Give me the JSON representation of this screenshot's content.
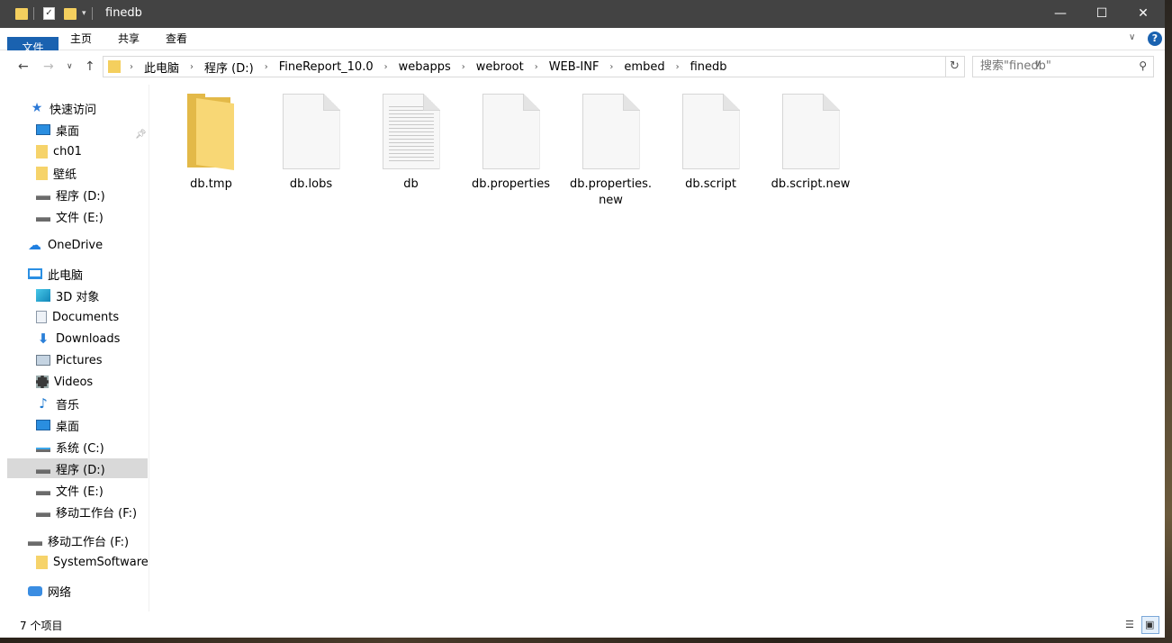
{
  "window": {
    "title": "finedb",
    "controls": [
      "minimize-icon",
      "maximize-icon",
      "close-icon"
    ]
  },
  "ribbon": {
    "tabs": [
      "文件",
      "主页",
      "共享",
      "查看"
    ]
  },
  "address": {
    "breadcrumbs": [
      "此电脑",
      "程序 (D:)",
      "FineReport_10.0",
      "webapps",
      "webroot",
      "WEB-INF",
      "embed",
      "finedb"
    ]
  },
  "search": {
    "placeholder": "搜索\"finedb\""
  },
  "sidebar": {
    "quick_access": "快速访问",
    "quick_items": [
      "桌面",
      "ch01",
      "壁纸",
      "程序 (D:)",
      "文件 (E:)"
    ],
    "onedrive": "OneDrive",
    "this_pc": "此电脑",
    "pc_items": [
      "3D 对象",
      "Documents",
      "Downloads",
      "Pictures",
      "Videos",
      "音乐",
      "桌面",
      "系统 (C:)",
      "程序 (D:)",
      "文件 (E:)",
      "移动工作台 (F:)"
    ],
    "removable": "移动工作台 (F:)",
    "removable_items": [
      "SystemSoftware"
    ],
    "network": "网络",
    "selected": "程序 (D:)"
  },
  "files": [
    {
      "name": "db.tmp",
      "type": "folder"
    },
    {
      "name": "db.lobs",
      "type": "blank"
    },
    {
      "name": "db",
      "type": "text"
    },
    {
      "name": "db.properties",
      "type": "blank"
    },
    {
      "name": "db.properties.new",
      "type": "blank"
    },
    {
      "name": "db.script",
      "type": "blank"
    },
    {
      "name": "db.script.new",
      "type": "blank"
    }
  ],
  "status": {
    "item_count": "7 个项目"
  }
}
